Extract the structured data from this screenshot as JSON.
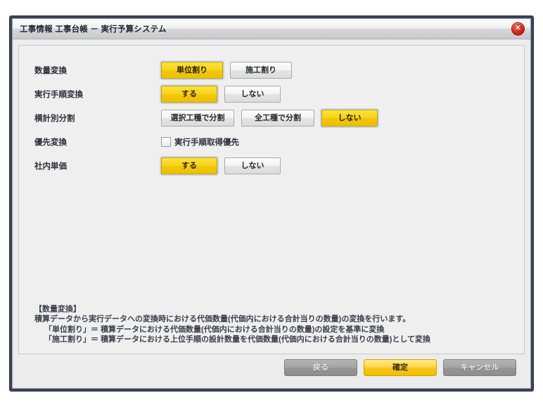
{
  "window": {
    "title": "工事情報 工事台帳 － 実行予算システム",
    "close_icon": "close-icon",
    "close_glyph": "✕"
  },
  "form": {
    "rows": [
      {
        "label": "数量変換",
        "type": "segmented",
        "options": [
          {
            "label": "単位割り",
            "selected": true
          },
          {
            "label": "施工割り",
            "selected": false
          }
        ]
      },
      {
        "label": "実行手順変換",
        "type": "segmented",
        "options": [
          {
            "label": "する",
            "selected": true
          },
          {
            "label": "しない",
            "selected": false
          }
        ]
      },
      {
        "label": "横計別分割",
        "type": "segmented",
        "options": [
          {
            "label": "選択工種で分割",
            "selected": false
          },
          {
            "label": "全工種で分割",
            "selected": false
          },
          {
            "label": "しない",
            "selected": true
          }
        ]
      },
      {
        "label": "優先変換",
        "type": "checkbox",
        "checkbox": {
          "label": "実行手順取得優先",
          "checked": false
        }
      },
      {
        "label": "社内単価",
        "type": "segmented",
        "options": [
          {
            "label": "する",
            "selected": true
          },
          {
            "label": "しない",
            "selected": false
          }
        ]
      }
    ]
  },
  "note": {
    "lines": [
      "【数量変換】",
      "積算データから実行データへの変換時における代価数量(代価内における合計当りの数量)の変換を行います。",
      "「単位割り」＝ 積算データにおける代価数量(代価内における合計当りの数量)の設定を基準に変換",
      "「施工割り」＝ 積算データにおける上位手順の設計数量を代価数量(代価内における合計当りの数量)として変換"
    ]
  },
  "footer": {
    "buttons": [
      {
        "label": "戻る",
        "style": "grey"
      },
      {
        "label": "確定",
        "style": "primary"
      },
      {
        "label": "キャンセル",
        "style": "grey"
      }
    ]
  },
  "colors": {
    "frame": "#3c4458",
    "accent_yellow": "#f5c61b",
    "close_red": "#d0231c",
    "panel_bg": "#efefef",
    "focus_ring": "#c7d4e6"
  }
}
